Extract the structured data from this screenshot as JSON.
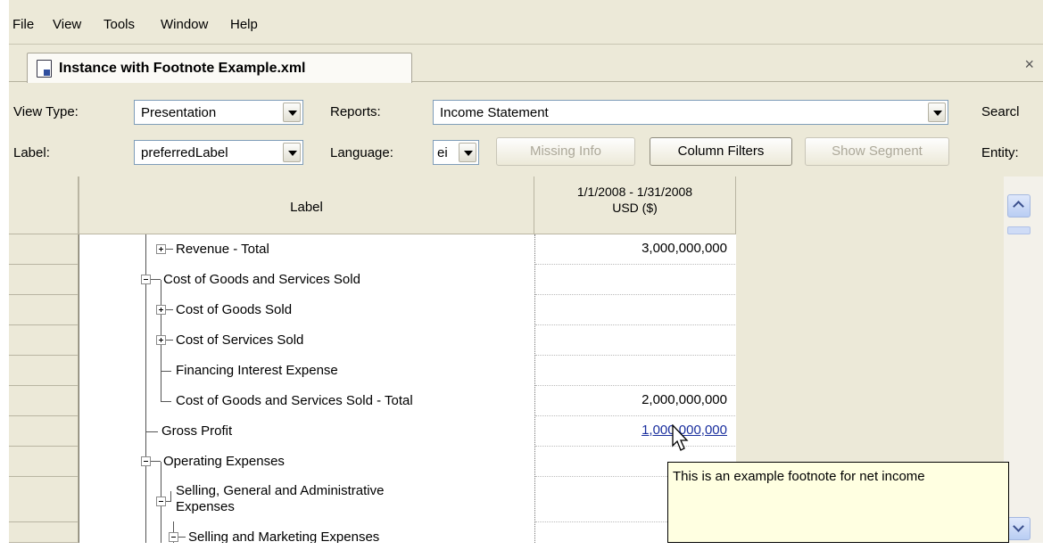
{
  "menubar": {
    "items": [
      "File",
      "View",
      "Tools",
      "Window",
      "Help"
    ]
  },
  "tab": {
    "title": "Instance with Footnote Example.xml",
    "close_glyph": "×"
  },
  "toolbar": {
    "view_type_label": "View Type:",
    "view_type_value": "Presentation",
    "reports_label": "Reports:",
    "reports_value": "Income Statement",
    "search_label": "Searcl",
    "label_label": "Label:",
    "label_value": "preferredLabel",
    "language_label": "Language:",
    "language_value": "ei",
    "missing_info": "Missing Info",
    "column_filters": "Column Filters",
    "show_segment": "Show Segment",
    "entity_label": "Entity:"
  },
  "grid": {
    "label_header": "Label",
    "period_header_line1": "1/1/2008 - 1/31/2008",
    "period_header_line2": "USD ($)",
    "rows": [
      {
        "label": "Revenue - Total",
        "value": "3,000,000,000"
      },
      {
        "label": "Cost of Goods and Services Sold",
        "value": ""
      },
      {
        "label": "Cost of Goods Sold",
        "value": ""
      },
      {
        "label": "Cost of Services Sold",
        "value": ""
      },
      {
        "label": "Financing Interest Expense",
        "value": ""
      },
      {
        "label": "Cost of Goods and Services Sold - Total",
        "value": "2,000,000,000"
      },
      {
        "label": "Gross Profit",
        "value": "1,000,000,000"
      },
      {
        "label": "Operating Expenses",
        "value": ""
      },
      {
        "label": "Selling, General and Administrative",
        "label_line2": "Expenses",
        "value": ""
      },
      {
        "label": "Selling and Marketing Expenses",
        "value": ""
      }
    ]
  },
  "tooltip": {
    "text": "This is an example footnote for net income"
  },
  "colors": {
    "window_bg": "#ece9d8",
    "tooltip_bg": "#ffffe1",
    "link": "#1a2f9e"
  }
}
